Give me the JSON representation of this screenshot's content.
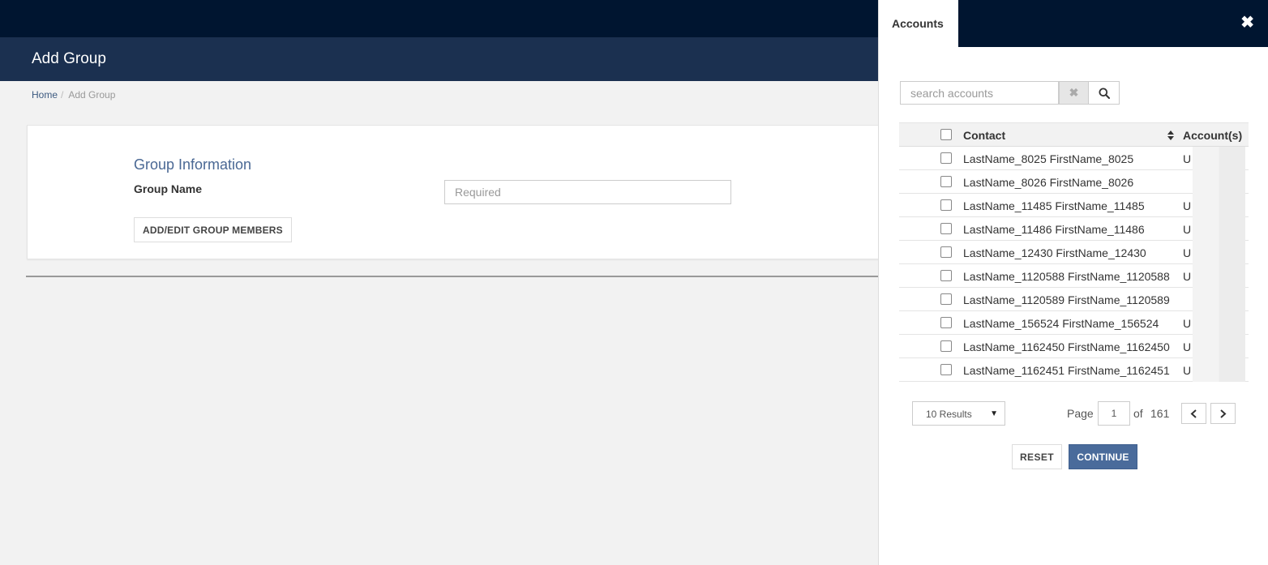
{
  "header": {
    "title": "Add Group"
  },
  "breadcrumb": {
    "home": "Home",
    "separator": "/",
    "current": "Add Group"
  },
  "form": {
    "section_title": "Group Information",
    "group_name_label": "Group Name",
    "group_name_placeholder": "Required",
    "group_name_value": "",
    "members_button": "ADD/EDIT GROUP MEMBERS"
  },
  "panel": {
    "tab_label": "Accounts",
    "close_icon": "close-icon",
    "search": {
      "placeholder": "search accounts",
      "value": "",
      "clear_glyph": "✖"
    },
    "table": {
      "headers": {
        "contact": "Contact",
        "accounts": "Account(s)"
      },
      "rows": [
        {
          "contact": "LastName_8025 FirstName_8025",
          "account": "U"
        },
        {
          "contact": "LastName_8026 FirstName_8026",
          "account": ""
        },
        {
          "contact": "LastName_11485 FirstName_11485",
          "account": "U"
        },
        {
          "contact": "LastName_11486 FirstName_11486",
          "account": "U"
        },
        {
          "contact": "LastName_12430 FirstName_12430",
          "account": "U"
        },
        {
          "contact": "LastName_1120588 FirstName_1120588",
          "account": "U"
        },
        {
          "contact": "LastName_1120589 FirstName_1120589",
          "account": ""
        },
        {
          "contact": "LastName_156524 FirstName_156524",
          "account": "U"
        },
        {
          "contact": "LastName_1162450 FirstName_1162450",
          "account": "U"
        },
        {
          "contact": "LastName_1162451 FirstName_1162451",
          "account": "U"
        }
      ]
    },
    "pagination": {
      "results_per_page": "10 Results",
      "page_label": "Page",
      "current_page": "1",
      "of_label": "of",
      "total_pages": "161"
    },
    "buttons": {
      "reset": "RESET",
      "continue": "CONTINUE"
    }
  },
  "colors": {
    "topbar": "#001530",
    "titlebar": "#1b3050",
    "accent": "#4a6b9b",
    "section_title": "#4a6894"
  }
}
